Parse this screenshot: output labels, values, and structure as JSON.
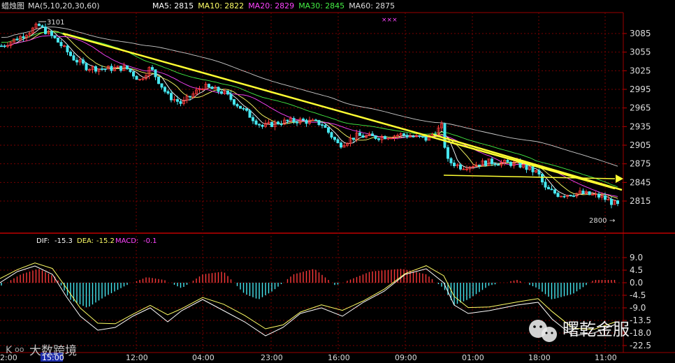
{
  "header": {
    "instrument": "蜡烛图",
    "ma_setting": "MA(5,10,20,30,60)",
    "ma_items": [
      {
        "label": "MA5:",
        "value": "2815",
        "color": "#ffffff"
      },
      {
        "label": "MA10:",
        "value": "2822",
        "color": "#ffff66"
      },
      {
        "label": "MA20:",
        "value": "2829",
        "color": "#ff44ff"
      },
      {
        "label": "MA30:",
        "value": "2845",
        "color": "#44ee44"
      },
      {
        "label": "MA60:",
        "value": "2875",
        "color": "#dddddd"
      }
    ],
    "marker": "×××"
  },
  "price_panel": {
    "high_label": "3101",
    "low_label": "2800",
    "ticks": [
      "3085",
      "3055",
      "3025",
      "2995",
      "2965",
      "2935",
      "2905",
      "2875",
      "2845",
      "2815"
    ]
  },
  "macd_panel": {
    "dif_label": "DIF:",
    "dif_value": "-15.3",
    "dea_label": "DEA:",
    "dea_value": "-15.2",
    "macd_label": "MACD:",
    "macd_value": "-0.1",
    "ticks": [
      "9.0",
      "4.5",
      "0.0",
      "-4.5",
      "-9.0",
      "-13.5",
      "-18.0",
      "-22.5"
    ]
  },
  "time_axis": {
    "labels": [
      "12:00",
      "04:00",
      "23:00",
      "16:00",
      "09:00",
      "01:00",
      "18:00",
      "11:00"
    ],
    "left_partial": "2:00",
    "cursor_label": "15:00"
  },
  "watermarks": {
    "bottom_left": "大数跨境",
    "bottom_right": "曙乾金服"
  },
  "colors": {
    "background": "#000000",
    "grid": "#7a0000",
    "up": "#ff3a3a",
    "down": "#46e6ef",
    "trendline": "#ffff33"
  },
  "chart_data": {
    "type": "candlestick",
    "title": "",
    "price_range": [
      2790,
      3105
    ],
    "indicator": "MACD",
    "macd_range": [
      -24,
      11
    ],
    "trendlines": [
      "descending from 3101 high toward ~2840",
      "descending second leg",
      "horizontal support near 2850"
    ]
  }
}
